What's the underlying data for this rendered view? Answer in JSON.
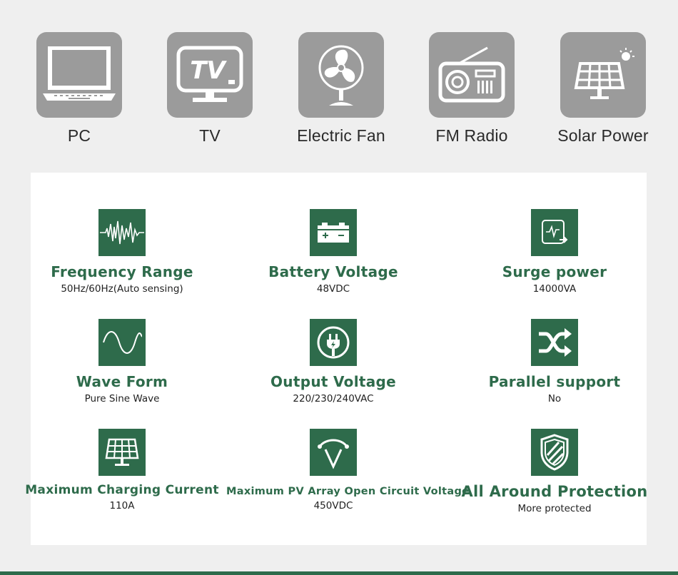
{
  "devices": [
    {
      "label": "PC",
      "icon": "laptop-icon"
    },
    {
      "label": "TV",
      "icon": "tv-icon"
    },
    {
      "label": "Electric Fan",
      "icon": "fan-icon"
    },
    {
      "label": "FM Radio",
      "icon": "radio-icon"
    },
    {
      "label": "Solar Power",
      "icon": "solar-panel-icon"
    }
  ],
  "tv_logo_text": "TV",
  "features": [
    {
      "title": "Frequency Range",
      "value": "50Hz/60Hz(Auto sensing)",
      "icon": "frequency-wave-icon"
    },
    {
      "title": "Battery Voltage",
      "value": "48VDC",
      "icon": "battery-icon"
    },
    {
      "title": "Surge power",
      "value": "14000VA",
      "icon": "surge-icon"
    },
    {
      "title": "Wave Form",
      "value": "Pure Sine Wave",
      "icon": "sine-wave-icon"
    },
    {
      "title": "Output Voltage",
      "value": "220/230/240VAC",
      "icon": "plug-icon"
    },
    {
      "title": "Parallel support",
      "value": "No",
      "icon": "shuffle-icon"
    },
    {
      "title": "Maximum Charging Current",
      "value": "110A",
      "icon": "solar-panel-icon"
    },
    {
      "title": "Maximum PV Array Open Circuit Voltage",
      "value": "450VDC",
      "icon": "voltage-icon"
    },
    {
      "title": "All Around Protection",
      "value": "More protected",
      "icon": "shield-icon"
    }
  ],
  "colors": {
    "accent": "#2e6b4b",
    "tile_gray": "#9b9b9b",
    "background": "#efefef"
  }
}
